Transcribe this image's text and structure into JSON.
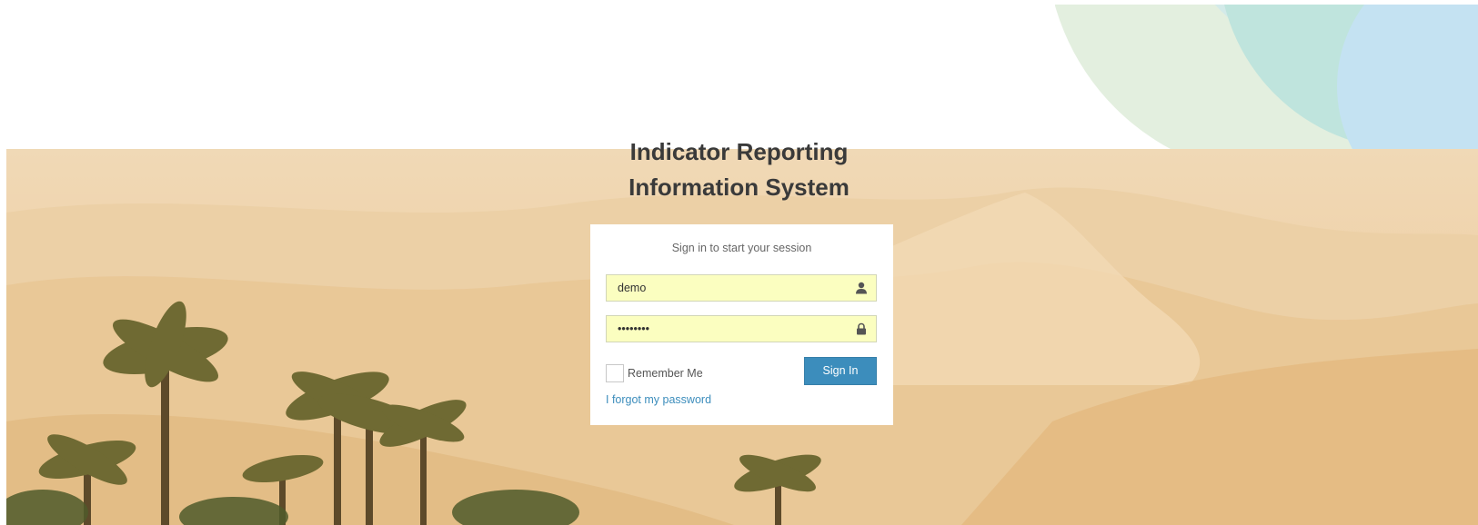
{
  "page": {
    "title_line1": "Indicator Reporting",
    "title_line2": "Information System"
  },
  "login": {
    "message": "Sign in to start your session",
    "username_value": "demo",
    "password_value": "••••••••",
    "username_icon": "user-icon",
    "password_icon": "lock-icon",
    "remember_label": "Remember Me",
    "remember_checked": false,
    "signin_label": "Sign In",
    "forgot_label": "I forgot my password"
  },
  "colors": {
    "primary": "#3c8dbc",
    "field_autofill": "#fbfec0",
    "title": "#3a3a3a"
  }
}
